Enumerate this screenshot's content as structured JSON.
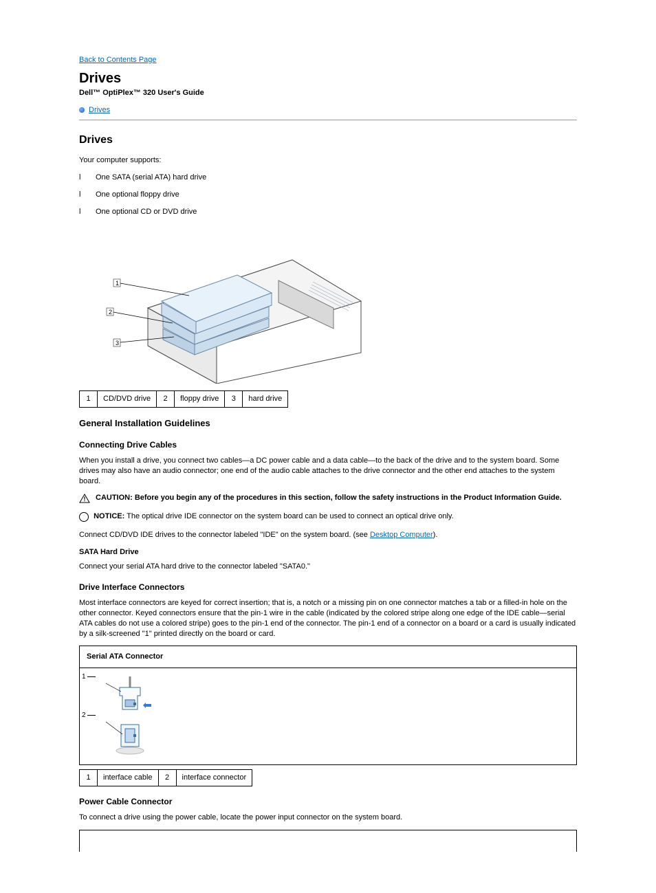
{
  "nav": {
    "back": "Back to Contents Page"
  },
  "header": {
    "title": "Drives",
    "product": "Dell™ OptiPlex™ 320 User's Guide",
    "topic": "Drives"
  },
  "intro": {
    "para": "Your computer supports:",
    "items": [
      "One SATA (serial ATA) hard drive",
      "One optional floppy drive",
      "One optional CD or DVD drive"
    ]
  },
  "fig1": {
    "callouts": [
      {
        "n": "1",
        "label": "CD/DVD drive"
      },
      {
        "n": "2",
        "label": "floppy drive"
      },
      {
        "n": "3",
        "label": "hard drive"
      }
    ]
  },
  "guidelines": {
    "heading": "General Installation Guidelines",
    "connecting_heading": "Connecting Drive Cables",
    "connecting_para": "When you install a drive, you connect two cables—a DC power cable and a data cable—to the back of the drive and to the system board. Some drives may also have an audio connector; one end of the audio cable attaches to the drive connector and the other end attaches to the system board.",
    "ide_caution": "CAUTION: Before you begin any of the procedures in this section, follow the safety instructions in the Product Information Guide.",
    "ide_notice_pre": "NOTICE:",
    "ide_notice_text": " The optical drive IDE connector on the system board can be used to connect an optical drive only.",
    "ide_para_parts": {
      "pre": "Connect CD/DVD IDE drives to the connector labeled \"IDE\" on the system board. (see ",
      "link": "Desktop Computer",
      "post": ")."
    },
    "sata_heading": "SATA Hard Drive",
    "sata_para": "Connect your serial ATA hard drive to the connector labeled \"SATA0.\"",
    "interface_heading": "Drive Interface Connectors",
    "interface_para": "Most interface connectors are keyed for correct insertion; that is, a notch or a missing pin on one connector matches a tab or a filled-in hole on the other connector. Keyed connectors ensure that the pin-1 wire in the cable (indicated by the colored stripe along one edge of the IDE cable—serial ATA cables do not use a colored stripe) goes to the pin-1 end of the connector. The pin-1 end of a connector on a board or a card is usually indicated by a silk-screened \"1\" printed directly on the board or card."
  },
  "fig2": {
    "caption": "Serial ATA Connector",
    "callouts": [
      {
        "n": "1",
        "label": "interface cable"
      },
      {
        "n": "2",
        "label": "interface connector"
      }
    ]
  },
  "power": {
    "heading": "Power Cable Connector",
    "para": "To connect a drive using the power cable, locate the power input connector on the system board."
  }
}
